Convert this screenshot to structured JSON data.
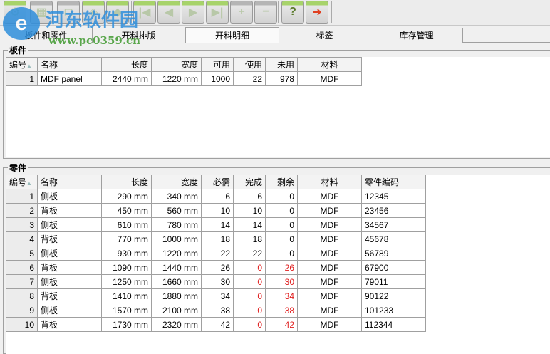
{
  "toolbar": {
    "buttons": [
      {
        "name": "settings",
        "icon": "gear-icon",
        "glyph": "⚙"
      },
      {
        "name": "layout",
        "icon": "layout-image-icon",
        "glyph": "▦"
      },
      {
        "name": "edit",
        "icon": "edit-icon",
        "glyph": "◻"
      },
      {
        "name": "optimize",
        "icon": "optimize-icon",
        "glyph": "◈"
      },
      {
        "name": "refresh",
        "icon": "refresh-icon",
        "glyph": "◆"
      },
      {
        "name": "first",
        "icon": "first-icon",
        "glyph": "|◀"
      },
      {
        "name": "prev",
        "icon": "prev-icon",
        "glyph": "◀"
      },
      {
        "name": "next",
        "icon": "next-icon",
        "glyph": "▶"
      },
      {
        "name": "last",
        "icon": "last-icon",
        "glyph": "▶|"
      },
      {
        "name": "add",
        "icon": "plus-icon",
        "glyph": "+"
      },
      {
        "name": "remove",
        "icon": "minus-icon",
        "glyph": "−"
      },
      {
        "name": "help",
        "icon": "help-icon",
        "glyph": "?"
      },
      {
        "name": "exit",
        "icon": "exit-icon",
        "glyph": "➜"
      }
    ]
  },
  "watermark": {
    "title": "河东软件园",
    "url": "www.pc0359.cn"
  },
  "tabs": [
    "板件和零件",
    "开料排版",
    "开料明细",
    "标签",
    "库存管理"
  ],
  "boards": {
    "label": "板件",
    "headers": [
      "编号",
      "名称",
      "长度",
      "宽度",
      "可用",
      "使用",
      "未用",
      "材料"
    ],
    "rows": [
      [
        "1",
        "MDF panel",
        "2440 mm",
        "1220 mm",
        "1000",
        "22",
        "978",
        "MDF"
      ]
    ]
  },
  "parts": {
    "label": "零件",
    "headers": [
      "编号",
      "名称",
      "长度",
      "宽度",
      "必需",
      "完成",
      "剩余",
      "材料",
      "零件编码"
    ],
    "rows": [
      [
        "1",
        "侧板",
        "290 mm",
        "340 mm",
        "6",
        "6",
        "0",
        "MDF",
        "12345"
      ],
      [
        "2",
        "背板",
        "450 mm",
        "560 mm",
        "10",
        "10",
        "0",
        "MDF",
        "23456"
      ],
      [
        "3",
        "侧板",
        "610 mm",
        "780 mm",
        "14",
        "14",
        "0",
        "MDF",
        "34567"
      ],
      [
        "4",
        "背板",
        "770 mm",
        "1000 mm",
        "18",
        "18",
        "0",
        "MDF",
        "45678"
      ],
      [
        "5",
        "侧板",
        "930 mm",
        "1220 mm",
        "22",
        "22",
        "0",
        "MDF",
        "56789"
      ],
      [
        "6",
        "背板",
        "1090 mm",
        "1440 mm",
        "26",
        "0",
        "26",
        "MDF",
        "67900"
      ],
      [
        "7",
        "侧板",
        "1250 mm",
        "1660 mm",
        "30",
        "0",
        "30",
        "MDF",
        "79011"
      ],
      [
        "8",
        "背板",
        "1410 mm",
        "1880 mm",
        "34",
        "0",
        "34",
        "MDF",
        "90122"
      ],
      [
        "9",
        "侧板",
        "1570 mm",
        "2100 mm",
        "38",
        "0",
        "38",
        "MDF",
        "101233"
      ],
      [
        "10",
        "背板",
        "1730 mm",
        "2320 mm",
        "42",
        "0",
        "42",
        "MDF",
        "112344"
      ]
    ]
  },
  "colors": {
    "incomplete": "#e02020",
    "toolbar_accent": "#a7d36a"
  }
}
